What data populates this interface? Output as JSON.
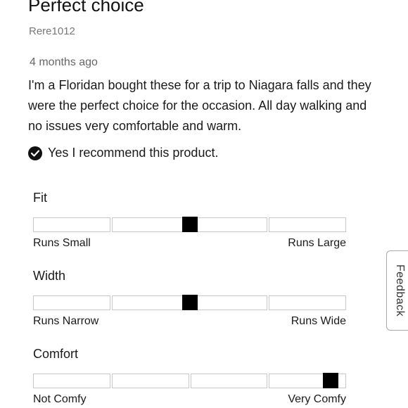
{
  "review": {
    "title": "Perfect choice",
    "reviewer": "Rere1012",
    "date": "4 months ago",
    "body": "I'm a Floridan bought these for a trip to Niagara falls and they were the perfect choice for the occasion. All day walking and no issues very comfortable and warm.",
    "recommend_text": "Yes I recommend this product."
  },
  "ratings": [
    {
      "label": "Fit",
      "low_label": "Runs Small",
      "high_label": "Runs Large",
      "level_fraction": 0.5
    },
    {
      "label": "Width",
      "low_label": "Runs Narrow",
      "high_label": "Runs Wide",
      "level_fraction": 0.5
    },
    {
      "label": "Comfort",
      "low_label": "Not Comfy",
      "high_label": "Very Comfy",
      "level_fraction": 0.95
    }
  ],
  "feedback_tab": {
    "label": "Feedback"
  },
  "icons": {
    "recommend": "check-circle-icon"
  },
  "colors": {
    "marker": "#000000",
    "segment_border": "#c8c8c8"
  }
}
